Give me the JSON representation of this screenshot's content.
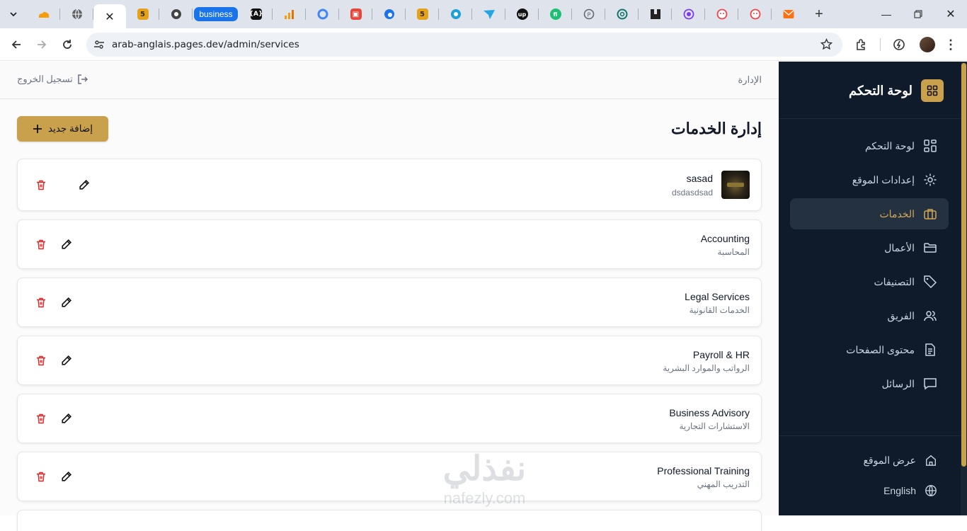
{
  "browser": {
    "tabs": [
      {
        "icon": "cloud-favicon",
        "color": "#f59e0b"
      },
      {
        "icon": "globe-favicon",
        "color": "#5f6368"
      },
      {
        "icon": "close-icon",
        "color": "#222"
      },
      {
        "icon": "html5-favicon",
        "color": "#e3a21a",
        "text": "5"
      },
      {
        "icon": "chrome-favicon",
        "color": "#444"
      },
      {
        "icon": "business-pill",
        "text": "business"
      },
      {
        "icon": "code-favicon",
        "color": "#111"
      },
      {
        "icon": "analytics-favicon",
        "color": "#f59e0b"
      },
      {
        "icon": "circle-favicon",
        "color": "#4285f4"
      },
      {
        "icon": "red-favicon",
        "color": "#e5483b"
      },
      {
        "icon": "blue-favicon",
        "color": "#1a73e8"
      },
      {
        "icon": "html5-favicon",
        "color": "#e3a21a",
        "text": "5"
      },
      {
        "icon": "teal-circle-favicon",
        "color": "#1ba0d8"
      },
      {
        "icon": "bird-favicon",
        "color": "#22a5e0"
      },
      {
        "icon": "upwork-favicon",
        "color": "#111",
        "text": "up"
      },
      {
        "icon": "fiverr-favicon",
        "color": "#1dbf73",
        "text": "fi"
      },
      {
        "icon": "p-favicon",
        "color": "#5f6368"
      },
      {
        "icon": "openai-favicon",
        "color": "#0f766e"
      },
      {
        "icon": "grid-favicon",
        "color": "#222"
      },
      {
        "icon": "purple-favicon",
        "color": "#7c3aed"
      },
      {
        "icon": "face-favicon",
        "color": "#ef4444"
      },
      {
        "icon": "face-favicon",
        "color": "#ef4444"
      },
      {
        "icon": "mail-favicon",
        "color": "#f97316"
      }
    ],
    "url": "arab-anglais.pages.dev/admin/services"
  },
  "topbar": {
    "breadcrumb": "الإدارة",
    "logout_label": "تسجيل الخروج"
  },
  "header": {
    "title": "إدارة الخدمات",
    "add_button": "إضافة جديد"
  },
  "services": [
    {
      "title": "sasad",
      "subtitle": "dsdasdsad",
      "has_image": true
    },
    {
      "title": "Accounting",
      "subtitle": "المحاسبة"
    },
    {
      "title": "Legal Services",
      "subtitle": "الخدمات القانونية"
    },
    {
      "title": "Payroll & HR",
      "subtitle": "الرواتب والموارد البشرية"
    },
    {
      "title": "Business Advisory",
      "subtitle": "الاستشارات التجارية"
    },
    {
      "title": "Professional Training",
      "subtitle": "التدريب المهني"
    }
  ],
  "sidebar": {
    "brand": "لوحة التحكم",
    "items": [
      {
        "label": "لوحة التحكم",
        "icon": "dashboard-grid-icon"
      },
      {
        "label": "إعدادات الموقع",
        "icon": "gear-icon"
      },
      {
        "label": "الخدمات",
        "icon": "briefcase-icon",
        "active": true
      },
      {
        "label": "الأعمال",
        "icon": "folder-icon"
      },
      {
        "label": "التصنيفات",
        "icon": "tag-icon"
      },
      {
        "label": "الفريق",
        "icon": "users-icon"
      },
      {
        "label": "محتوى الصفحات",
        "icon": "document-icon"
      },
      {
        "label": "الرسائل",
        "icon": "message-icon"
      }
    ],
    "footer": [
      {
        "label": "عرض الموقع",
        "icon": "home-icon"
      },
      {
        "label": "English",
        "icon": "globe-icon"
      }
    ]
  },
  "watermark": {
    "arabic": "نفذلي",
    "latin": "nafezly.com"
  },
  "colors": {
    "accent": "#c9a14c",
    "sidebar_bg": "#0f1b2a",
    "delete": "#dc2626"
  }
}
